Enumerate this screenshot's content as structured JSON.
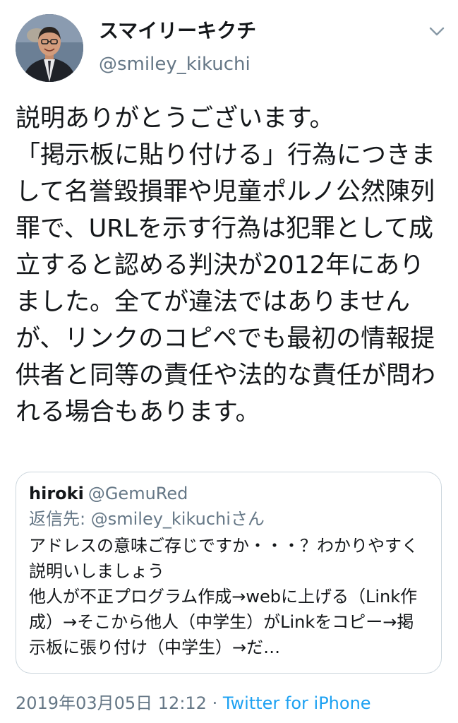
{
  "user": {
    "display_name": "スマイリーキクチ",
    "screen_name": "@smiley_kikuchi",
    "avatar_icon": "user-photo-avatar"
  },
  "menu": {
    "icon": "chevron-down-icon"
  },
  "tweet": {
    "text": "説明ありがとうございます。\n「掲示板に貼り付ける」行為につきまして名誉毀損罪や児童ポルノ公然陳列罪で、URLを示す行為は犯罪として成立すると認める判決が2012年にありました。全てが違法ではありませんが、リンクのコピペでも最初の情報提供者と同等の責任や法的な責任が問われる場合もあります。"
  },
  "quoted_tweet": {
    "name": "hiroki",
    "handle": "@GemuRed",
    "reply_prefix": "返信先: ",
    "reply_handle": "@smiley_kikuchiさん",
    "text": "アドレスの意味ご存じですか・・・？わかりやすく説明いしましょう\n他人が不正プログラム作成→webに上げる（Link作成）→そこから他人（中学生）がLinkをコピー→掲示板に張り付け（中学生）→だ…"
  },
  "meta": {
    "timestamp": "2019年03月05日 12:12",
    "separator": " · ",
    "source": "Twitter for iPhone"
  },
  "colors": {
    "text": "#14171a",
    "secondary": "#657786",
    "link": "#1da1f2",
    "border": "#ccd6dd"
  }
}
